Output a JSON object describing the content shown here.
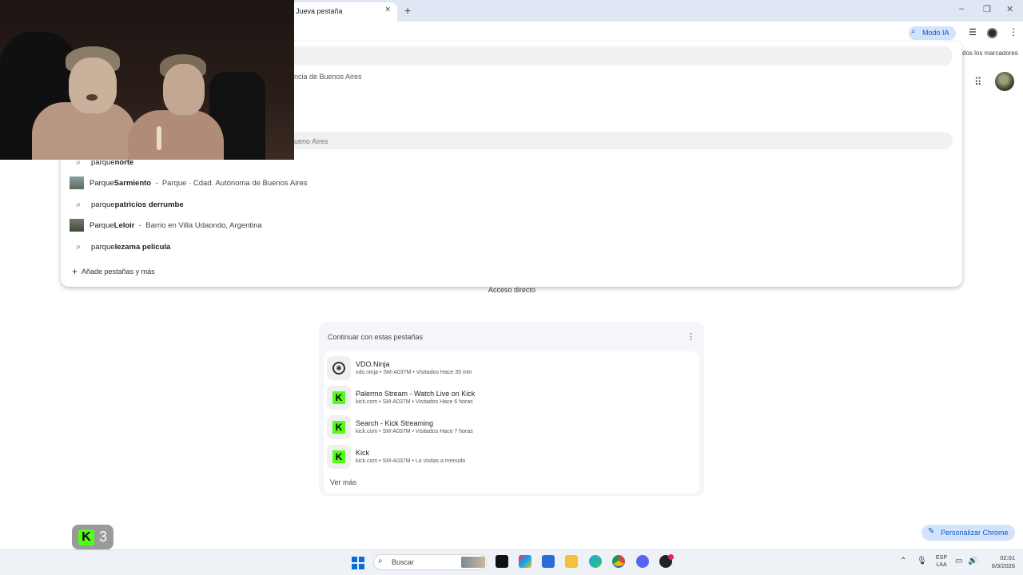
{
  "browser": {
    "tab_title": "Jueva pestaña",
    "tab_close": "×",
    "new_tab": "+",
    "window_controls": [
      "–",
      "❐",
      "✕"
    ],
    "modo_ia_label": "Modo IA",
    "bookmarks_label": "dos los marcadores"
  },
  "omnibox": {
    "line1": "ncia de Buenos Aires",
    "line2": "ueno Aires",
    "suggestions": [
      {
        "kind": "search",
        "prefix": "parque ",
        "bold": "norte",
        "sub": ""
      },
      {
        "kind": "place",
        "prefix": "Parque ",
        "bold": "Sarmiento",
        "sub": "  -  Parque · Cdad. Autónoma de Buenos Aires"
      },
      {
        "kind": "search",
        "prefix": "parque ",
        "bold": "patricios derrumbe",
        "sub": ""
      },
      {
        "kind": "place",
        "prefix": "Parque ",
        "bold": "Leloir",
        "sub": "  -  Barrio en Villa Udaondo, Argentina"
      },
      {
        "kind": "search",
        "prefix": "parque ",
        "bold": "lezama pelicula",
        "sub": ""
      }
    ],
    "add_tabs_label": "Añade pestañas y más"
  },
  "ntp": {
    "shortcut_label": "Acceso directo",
    "continue_title": "Continuar con estas pestañas",
    "tabs": [
      {
        "title": "VDO.Ninja",
        "meta": "vdo.ninja • SM-A037M • Visitados Hace 35 min",
        "icon": "vdo-ninja-icon"
      },
      {
        "title": "Palermo Stream - Watch Live on Kick",
        "meta": "kick.com • SM-A037M • Visitados Hace 6 horas",
        "icon": "kick-icon"
      },
      {
        "title": "Search - Kick Streaming",
        "meta": "kick.com • SM-A037M • Visitados Hace 7 horas",
        "icon": "kick-icon"
      },
      {
        "title": "Kick",
        "meta": "kick.com • SM-A037M • Lo visitas a menudo",
        "icon": "kick-icon"
      }
    ],
    "see_more": "Ver más",
    "customize_label": "Personalizar Chrome"
  },
  "kick_widget": {
    "letter": "K",
    "count": "3"
  },
  "taskbar": {
    "search_placeholder": "Buscar",
    "lang_top": "ESP",
    "lang_bottom": "LAA",
    "time": "02:01",
    "date": "6/3/2026"
  },
  "colors": {
    "kick_green": "#53fc18",
    "accent_blue": "#0b57d0",
    "chip_blue": "#d3e3fd"
  }
}
